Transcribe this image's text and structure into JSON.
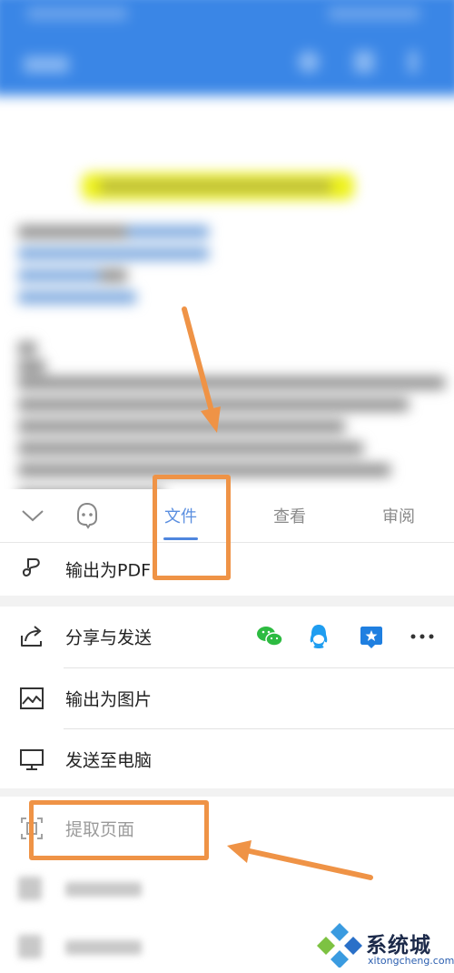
{
  "tabbar": {
    "tabs": [
      {
        "label": "文件",
        "active": true
      },
      {
        "label": "查看",
        "active": false
      },
      {
        "label": "审阅",
        "active": false
      }
    ]
  },
  "menu": {
    "export_pdf": "输出为PDF",
    "share_send": "分享与发送",
    "export_image": "输出为图片",
    "send_to_pc": "发送至电脑",
    "extract_pages": "提取页面"
  },
  "share_targets": [
    "wechat-icon",
    "qq-icon",
    "tim-icon",
    "more-icon"
  ],
  "colors": {
    "accent": "#4f86de",
    "annotation": "#ef9346",
    "app_bar": "#3a86e6",
    "wechat": "#2dbb41",
    "qq": "#1f9df0"
  },
  "watermark": {
    "brand": "系统城",
    "url": "xitongcheng.com"
  }
}
